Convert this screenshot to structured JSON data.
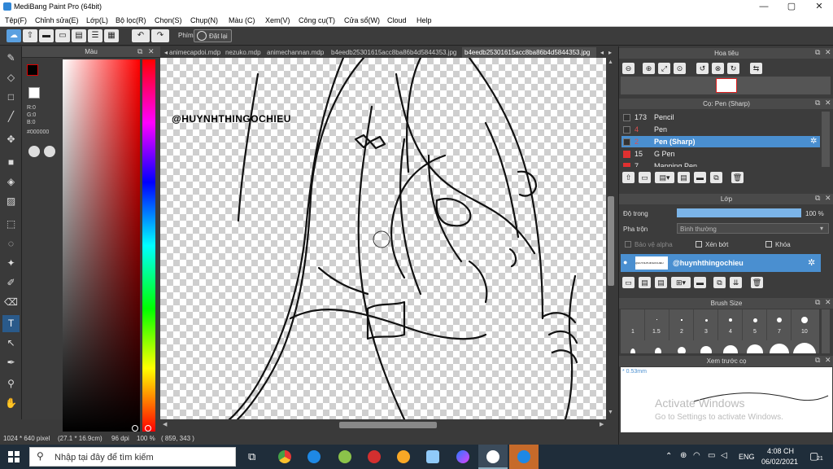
{
  "window": {
    "title": "MediBang Paint Pro (64bit)",
    "min": "—",
    "max": "▢",
    "close": "✕"
  },
  "menu": [
    "Tệp(F)",
    "Chỉnh sửa(E)",
    "Lớp(L)",
    "Bộ lọc(R)",
    "Chọn(S)",
    "Chụp(N)",
    "Màu (C)",
    "Xem(V)",
    "Công cụ(T)",
    "Cửa sổ(W)",
    "Cloud",
    "Help"
  ],
  "toolbar": {
    "phim_label": "Phím",
    "reset_label": "Đặt lại"
  },
  "color_panel": {
    "title": "Màu",
    "r": "R:0",
    "g": "G:0",
    "b": "B:0",
    "hex": "#000000"
  },
  "tabs": [
    "animecapdoi.mdp",
    "nezuko.mdp",
    "animechannan.mdp",
    "b4eedb25301615acc8ba86b4d5844353.jpg",
    "b4eedb25301615acc8ba86b4d5844353.jpg"
  ],
  "canvas": {
    "watermark": "@HUYNHTHINGOCHIEU"
  },
  "status": {
    "size": "1024 * 640 pixel",
    "cm": "(27.1 * 16.9cm)",
    "dpi": "96 dpi",
    "zoom": "100 %",
    "coords": "( 859, 343 )"
  },
  "navigator": {
    "title": "Hoa tiêu"
  },
  "brush_panel": {
    "title": "Cọ: Pen (Sharp)",
    "items": [
      {
        "size": "173",
        "name": "Pencil",
        "color": "#333333"
      },
      {
        "size": "4",
        "name": "Pen",
        "color": "#333333"
      },
      {
        "size": "2",
        "name": "Pen (Sharp)",
        "color": "#333333"
      },
      {
        "size": "15",
        "name": "G Pen",
        "color": "#e03030"
      },
      {
        "size": "7",
        "name": "Mapping Pen",
        "color": "#e03030"
      }
    ]
  },
  "layer_panel": {
    "title": "Lớp",
    "opacity_label": "Độ trong",
    "opacity_value": "100 %",
    "opacity": 1.0,
    "blend_label": "Pha trộn",
    "blend_value": "Bình thường",
    "protect_alpha": "Bảo vệ alpha",
    "clip": "Xén bớt",
    "lock": "Khóa",
    "layer_name": "@huynhthingochieu",
    "layer_thumb_text": "@HUYNHTHINGOCHIEU"
  },
  "brush_size": {
    "title": "Brush Size",
    "sizes": [
      "1",
      "1.5",
      "2",
      "3",
      "4",
      "5",
      "7",
      "10"
    ]
  },
  "preview": {
    "title": "Xem trước cọ",
    "size": "* 0.53mm"
  },
  "activate": {
    "line1": "Activate Windows",
    "line2": "Go to Settings to activate Windows."
  },
  "taskbar": {
    "search_placeholder": "Nhập tại đây để tìm kiếm",
    "lang": "ENG",
    "time": "4:08 CH",
    "date": "06/02/2021",
    "notif": "21"
  }
}
